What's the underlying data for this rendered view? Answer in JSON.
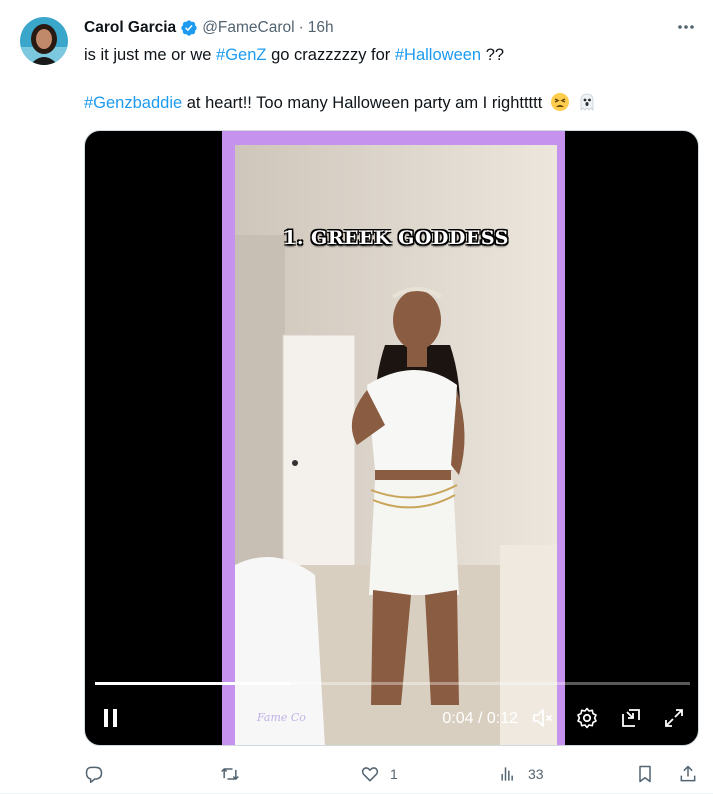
{
  "author": {
    "name": "Carol Garcia",
    "handle": "@FameCarol",
    "separator": "·",
    "time": "16h"
  },
  "tweet": {
    "line1": {
      "part1": "is it just me or we ",
      "tag1": "#GenZ",
      "part2": " go crazzzzzy for ",
      "tag2": "#Halloween",
      "part3": " ??"
    },
    "line2": {
      "tag": "#Genzbaddie",
      "text": " at heart!! Too many Halloween party am I righttttt"
    }
  },
  "video": {
    "caption": "1. GREEK GODDESS",
    "watermark": "Fame Co",
    "current_time": "0:04",
    "total_time": "0:12",
    "time_separator": " / ",
    "progress": 0.33
  },
  "actions": {
    "reply_count": "",
    "retweet_count": "",
    "like_count": "1",
    "views_count": "33"
  },
  "colors": {
    "accent": "#1d9bf0",
    "secondary_text": "#536471",
    "frame_purple": "#c592ee"
  },
  "icons": [
    "verified-badge-icon",
    "more-icon",
    "pause-icon",
    "mute-icon",
    "settings-icon",
    "pip-icon",
    "fullscreen-icon",
    "reply-icon",
    "retweet-icon",
    "like-icon",
    "views-icon",
    "bookmark-icon",
    "share-icon",
    "tired-face-emoji",
    "ghost-emoji"
  ]
}
